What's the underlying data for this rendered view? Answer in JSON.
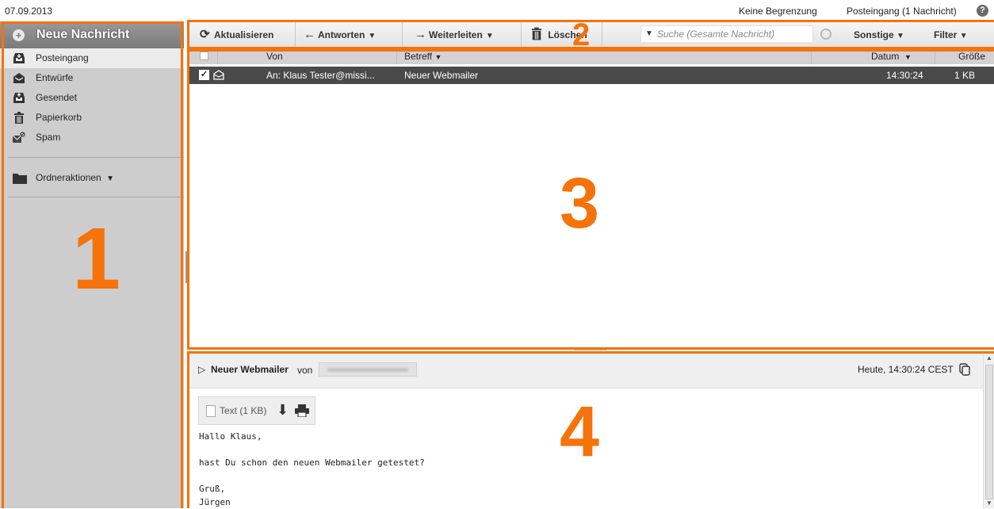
{
  "topbar": {
    "date": "07.09.2013",
    "limit": "Keine Begrenzung",
    "inbox_info": "Posteingang (1 Nachricht)",
    "help": "?"
  },
  "sidebar": {
    "new_message": "Neue Nachricht",
    "folders": [
      {
        "label": "Posteingang",
        "icon": "inbox-icon"
      },
      {
        "label": "Entwürfe",
        "icon": "drafts-icon"
      },
      {
        "label": "Gesendet",
        "icon": "sent-icon"
      },
      {
        "label": "Papierkorb",
        "icon": "trash-icon"
      },
      {
        "label": "Spam",
        "icon": "spam-icon"
      }
    ],
    "folder_actions": "Ordneraktionen"
  },
  "toolbar": {
    "refresh": "Aktualisieren",
    "reply": "Antworten",
    "forward": "Weiterleiten",
    "delete": "Löschen",
    "search_placeholder": "Suche (Gesamte Nachricht)",
    "more": "Sonstige",
    "filter": "Filter"
  },
  "list": {
    "headers": {
      "from": "Von",
      "subject": "Betreff",
      "date": "Datum",
      "size": "Größe"
    },
    "rows": [
      {
        "from": "An: Klaus Tester@missi...",
        "subject": "Neuer Webmailer",
        "date": "14:30:24",
        "size": "1 KB",
        "checked": true
      }
    ]
  },
  "preview": {
    "subject": "Neuer Webmailer",
    "von": "von",
    "when": "Heute, 14:30:24 CEST",
    "attachment": "Text (1 KB)",
    "body": [
      "Hallo Klaus,",
      "",
      "hast Du schon den neuen Webmailer getestet?",
      "",
      "Gruß,",
      "Jürgen"
    ]
  },
  "annotations": [
    "1",
    "2",
    "3",
    "4"
  ],
  "colors": {
    "annotation": "#f5730a",
    "selected_row": "#4a4a4a",
    "sidebar": "#cdcdcd"
  }
}
